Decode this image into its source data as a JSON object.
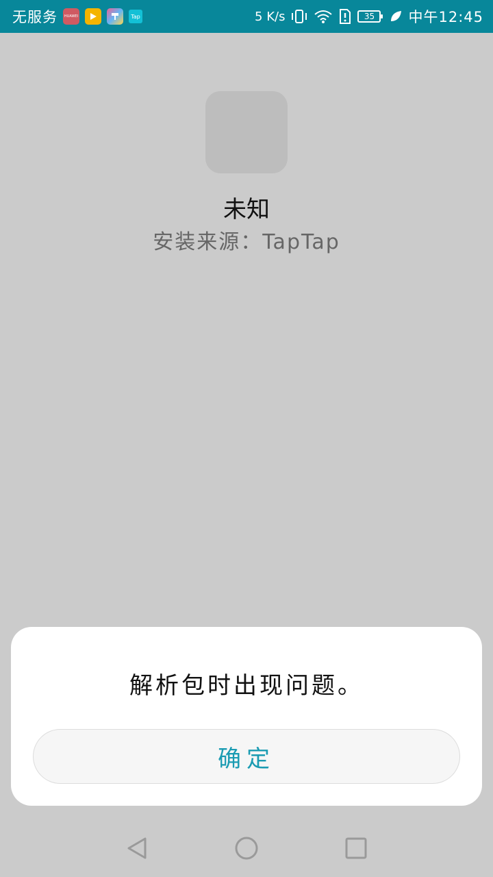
{
  "status_bar": {
    "carrier": "无服务",
    "apps": [
      {
        "icon": "huawei-appgallery-icon",
        "label": "HUAWEI"
      },
      {
        "icon": "video-app-icon",
        "label": ""
      },
      {
        "icon": "theme-app-icon",
        "label": ""
      },
      {
        "icon": "taptap-icon",
        "label": "Tap"
      }
    ],
    "network_speed": "5 K/s",
    "battery_level": "35",
    "time": "中午12:45"
  },
  "app_info": {
    "name": "未知",
    "source": "安装来源：TapTap"
  },
  "dialog": {
    "message": "解析包时出现问题。",
    "confirm_label": "确定"
  },
  "navigation": {
    "back_icon": "back-triangle-icon",
    "home_icon": "home-circle-icon",
    "recents_icon": "recents-square-icon"
  },
  "colors": {
    "status_bar": "#08879a",
    "background": "#cbcbcb",
    "accent": "#1a9bb2"
  }
}
